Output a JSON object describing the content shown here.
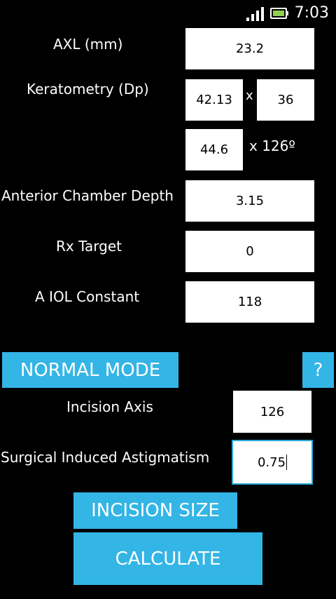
{
  "status": {
    "time": "7:03"
  },
  "form": {
    "axl_label": "AXL (mm)",
    "axl_value": "23.2",
    "kerato_label": "Keratometry (Dp)",
    "k1_value": "42.13",
    "k1_x": "x",
    "k1_axis": "36",
    "k2_value": "44.6",
    "k2_axis": "x 126º",
    "acd_label": "Anterior Chamber Depth",
    "acd_value": "3.15",
    "rx_label": "Rx Target",
    "rx_value": "0",
    "aconst_label": "A IOL Constant",
    "aconst_value": "118"
  },
  "mode": {
    "normal_mode_label": "NORMAL MODE",
    "help_label": "?"
  },
  "incision": {
    "axis_label": "Incision Axis",
    "axis_value": "126",
    "sia_label": "Surgical Induced Astigmatism",
    "sia_value": "0.75",
    "size_button": "INCISION SIZE"
  },
  "actions": {
    "calculate_label": "CALCULATE"
  },
  "colors": {
    "accent": "#33b5e5",
    "background": "#000000",
    "field_bg": "#ffffff"
  }
}
